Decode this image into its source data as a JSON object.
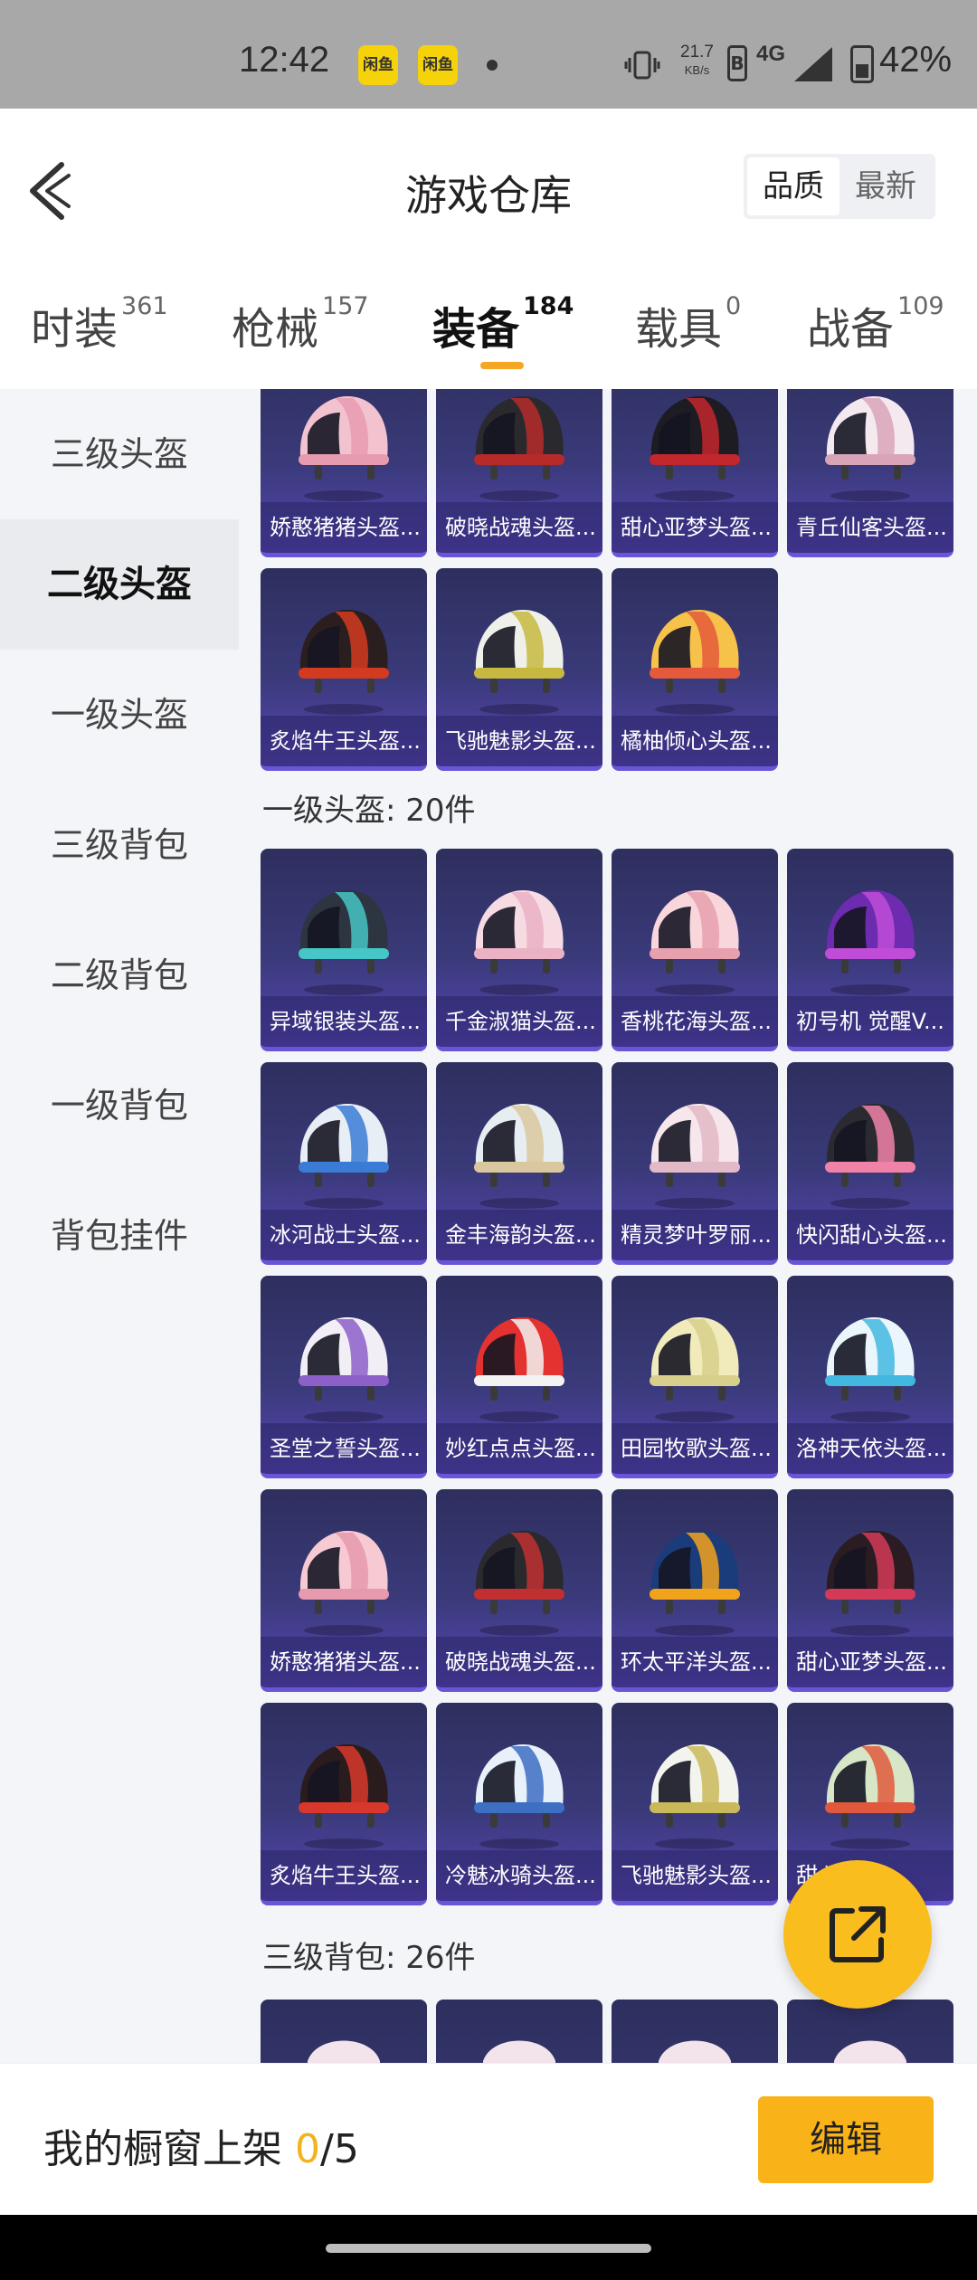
{
  "status_bar": {
    "time": "12:42",
    "app_badge_1": "闲鱼",
    "app_badge_2": "闲鱼",
    "net_speed_value": "21.7",
    "net_speed_unit": "KB/s",
    "volte": "B",
    "network": "4G",
    "battery_pct": "42%",
    "battery_level": 0.42
  },
  "header": {
    "title": "游戏仓库",
    "sort_quality": "品质",
    "sort_newest": "最新"
  },
  "tabs": [
    {
      "label": "时装",
      "count": "361"
    },
    {
      "label": "枪械",
      "count": "157"
    },
    {
      "label": "装备",
      "count": "184"
    },
    {
      "label": "载具",
      "count": "0"
    },
    {
      "label": "战备",
      "count": "109"
    }
  ],
  "sidebar": {
    "items": [
      {
        "label": "三级头盔"
      },
      {
        "label": "二级头盔"
      },
      {
        "label": "一级头盔"
      },
      {
        "label": "三级背包"
      },
      {
        "label": "二级背包"
      },
      {
        "label": "一级背包"
      },
      {
        "label": "背包挂件"
      }
    ]
  },
  "sections": {
    "level2_top": [
      "娇憨猪猪头盔...",
      "破晓战魂头盔...",
      "甜心亚梦头盔...",
      "青丘仙客头盔...",
      "炙焰牛王头盔...",
      "飞驰魅影头盔...",
      "橘柚倾心头盔..."
    ],
    "level1_header": "一级头盔: 20件",
    "level1": [
      "异域银装头盔...",
      "千金淑猫头盔...",
      "香桃花海头盔...",
      "初号机 觉醒V...",
      "冰河战士头盔...",
      "金丰海韵头盔...",
      "精灵梦叶罗丽...",
      "快闪甜心头盔...",
      "圣堂之誓头盔...",
      "妙红点点头盔...",
      "田园牧歌头盔...",
      "洛神天依头盔...",
      "娇憨猪猪头盔...",
      "破晓战魂头盔...",
      "环太平洋头盔...",
      "甜心亚梦头盔...",
      "炙焰牛王头盔...",
      "冷魅冰骑头盔...",
      "飞驰魅影头盔...",
      "甜心头盔..."
    ],
    "backpack_header": "三级背包: 26件"
  },
  "bottom_bar": {
    "label": "我的橱窗上架 ",
    "count": "0",
    "total": "/5",
    "edit": "编辑"
  },
  "colors": {
    "accent": "#f9b318",
    "card_top": "#2e2f5e",
    "card_bottom": "#5845b5"
  }
}
